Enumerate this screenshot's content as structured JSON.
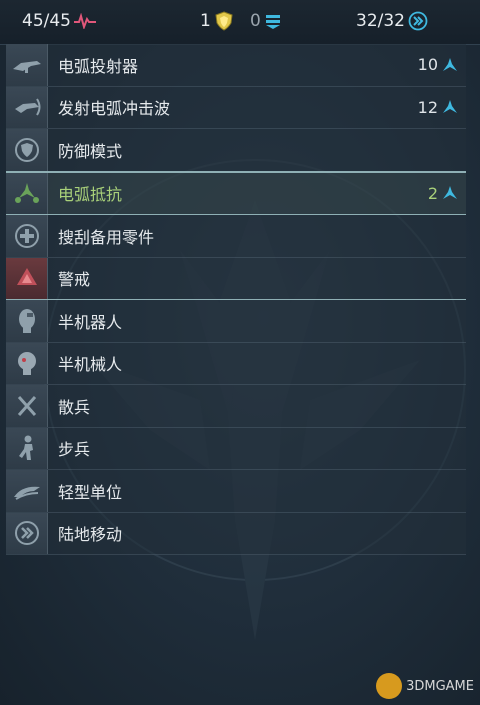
{
  "topbar": {
    "hp": "45/45",
    "shield": "1",
    "resource": "0",
    "move": "32/32"
  },
  "rows": [
    {
      "label": "电弧投射器",
      "value": "10",
      "icon": "arc-projector-icon"
    },
    {
      "label": "发射电弧冲击波",
      "value": "12",
      "icon": "arc-shockwave-icon"
    },
    {
      "label": "防御模式",
      "value": "",
      "icon": "defense-shield-icon"
    },
    {
      "label": "电弧抵抗",
      "value": "2",
      "icon": "arc-resistance-icon"
    },
    {
      "label": "搜刮备用零件",
      "value": "",
      "icon": "repair-cross-icon"
    },
    {
      "label": "警戒",
      "value": "",
      "icon": "alert-icon"
    },
    {
      "label": "半机器人",
      "value": "",
      "icon": "cyborg-icon"
    },
    {
      "label": "半机械人",
      "value": "",
      "icon": "android-icon"
    },
    {
      "label": "散兵",
      "value": "",
      "icon": "skirmisher-icon"
    },
    {
      "label": "步兵",
      "value": "",
      "icon": "infantry-icon"
    },
    {
      "label": "轻型单位",
      "value": "",
      "icon": "light-unit-icon"
    },
    {
      "label": "陆地移动",
      "value": "",
      "icon": "land-move-icon"
    }
  ],
  "watermark": "3DMGAME",
  "colors": {
    "highlight_text": "#a9d17a",
    "accent_cyan": "#3fb9e0",
    "heart_pink": "#e0577a"
  }
}
